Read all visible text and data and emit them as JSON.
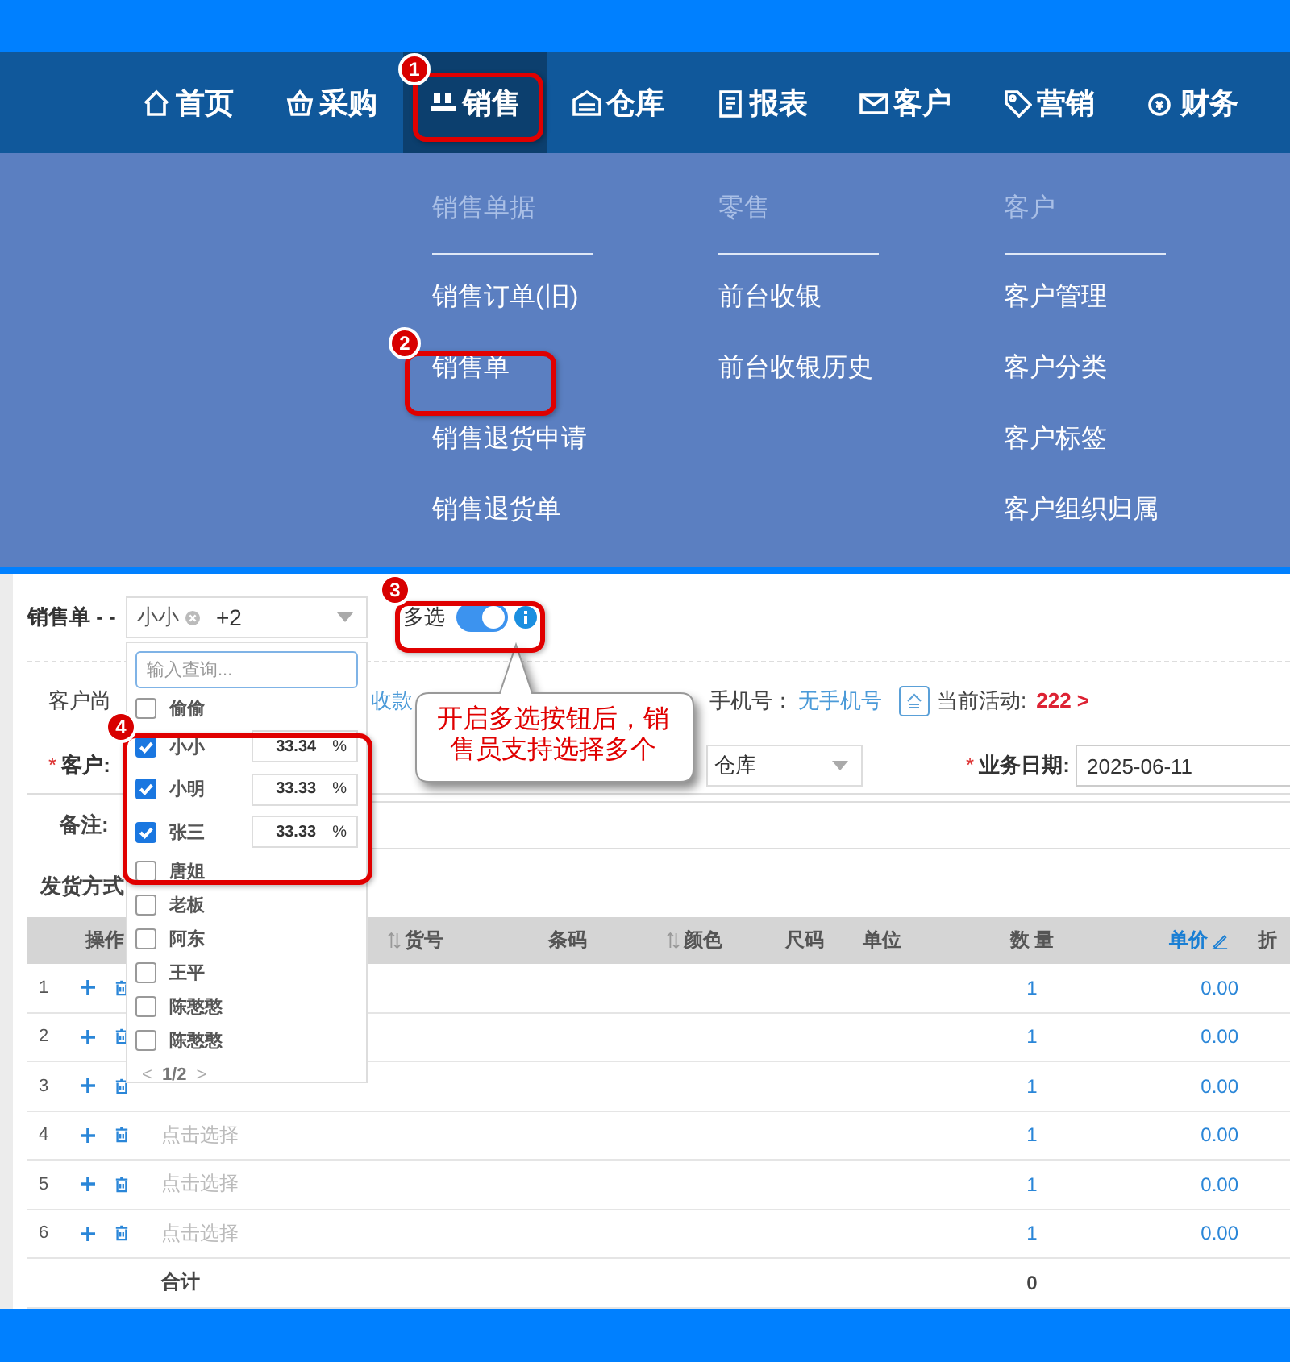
{
  "nav": {
    "items": [
      {
        "label": "首页",
        "selected": false
      },
      {
        "label": "采购",
        "selected": false
      },
      {
        "label": "销售",
        "selected": true
      },
      {
        "label": "仓库",
        "selected": false
      },
      {
        "label": "报表",
        "selected": false
      },
      {
        "label": "客户",
        "selected": false
      },
      {
        "label": "营销",
        "selected": false
      },
      {
        "label": "财务",
        "selected": false
      }
    ]
  },
  "mega_menu": {
    "columns": [
      {
        "heading": "销售单据",
        "items": [
          "销售订单(旧)",
          "销售单",
          "销售退货申请",
          "销售退货单"
        ]
      },
      {
        "heading": "零售",
        "items": [
          "前台收银",
          "前台收银历史"
        ]
      },
      {
        "heading": "客户",
        "items": [
          "客户管理",
          "客户分类",
          "客户标签",
          "客户组织归属"
        ]
      }
    ]
  },
  "form": {
    "title": "销售单 - -",
    "salesperson_select": {
      "chip": "小小",
      "more": "+2"
    },
    "multi_select": {
      "label": "多选",
      "on": true
    },
    "debt_label": "客户尚",
    "collect_link": "收款",
    "phone_label": "手机号：",
    "phone_value": "无手机号",
    "activity_label": "当前活动:",
    "activity_value": "222 >",
    "customer_mark": "*",
    "customer_label": "客户:",
    "warehouse_value": "仓库",
    "date_mark": "*",
    "date_label": "业务日期:",
    "date_value": "2025-06-11",
    "remark_label": "备注:",
    "shipping_label": "发货方式"
  },
  "salesperson_dropdown": {
    "search_placeholder": "输入查询...",
    "options": [
      {
        "name": "偷偷",
        "checked": false
      },
      {
        "name": "小小",
        "checked": true,
        "share": "33.34",
        "unit": "%"
      },
      {
        "name": "小明",
        "checked": true,
        "share": "33.33",
        "unit": "%"
      },
      {
        "name": "张三",
        "checked": true,
        "share": "33.33",
        "unit": "%"
      },
      {
        "name": "唐姐",
        "checked": false
      },
      {
        "name": "老板",
        "checked": false
      },
      {
        "name": "阿东",
        "checked": false
      },
      {
        "name": "王平",
        "checked": false
      },
      {
        "name": "陈憨憨",
        "checked": false
      },
      {
        "name": "陈憨憨",
        "checked": false
      }
    ],
    "pager": {
      "prev": "<",
      "page": "1/2",
      "next": ">"
    }
  },
  "table": {
    "columns": [
      {
        "label": "操作",
        "kind": "plain"
      },
      {
        "label": "货号",
        "kind": "sort"
      },
      {
        "label": "条码",
        "kind": "plain"
      },
      {
        "label": "颜色",
        "kind": "sort"
      },
      {
        "label": "尺码",
        "kind": "plain"
      },
      {
        "label": "单位",
        "kind": "plain"
      },
      {
        "label": "数 量",
        "kind": "plain"
      },
      {
        "label": "单价",
        "kind": "edit"
      },
      {
        "label": "折",
        "kind": "plain"
      }
    ],
    "rows": [
      {
        "index": "1",
        "quantity": "1",
        "price": "0.00"
      },
      {
        "index": "2",
        "quantity": "1",
        "price": "0.00"
      },
      {
        "index": "3",
        "quantity": "1",
        "price": "0.00"
      },
      {
        "index": "4",
        "quantity": "1",
        "price": "0.00",
        "placeholder": "点击选择"
      },
      {
        "index": "5",
        "quantity": "1",
        "price": "0.00",
        "placeholder": "点击选择"
      },
      {
        "index": "6",
        "quantity": "1",
        "price": "0.00",
        "placeholder": "点击选择"
      }
    ],
    "total": {
      "label": "合计",
      "quantity": "0"
    }
  },
  "annotations": {
    "markers": [
      "1",
      "2",
      "3",
      "4"
    ],
    "callout": "开启多选按钮后，销售员支持选择多个"
  }
}
